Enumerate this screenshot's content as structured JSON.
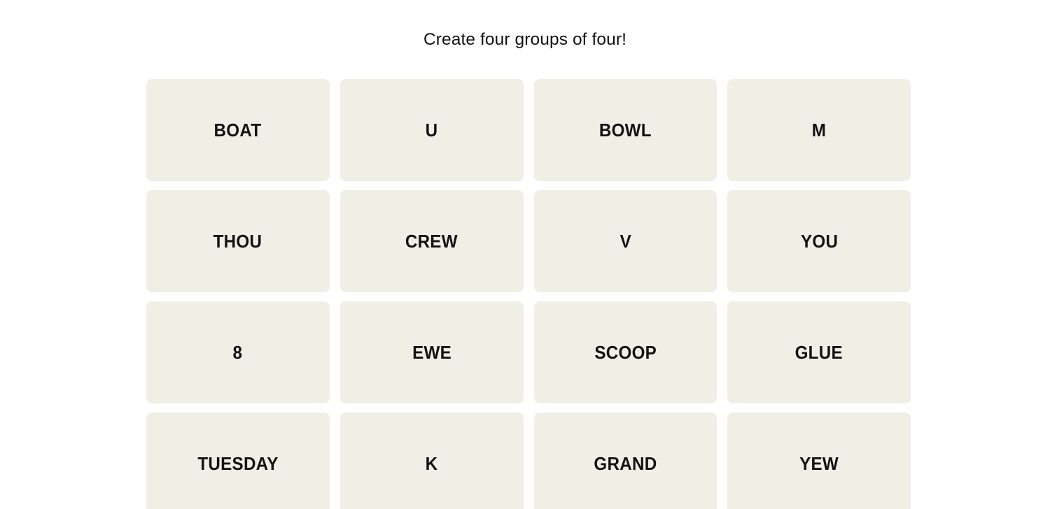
{
  "page": {
    "background_color": "#ffffff",
    "text_color": "#121212"
  },
  "header": {
    "instructions": "Create four groups of four!"
  },
  "board": {
    "rows": 4,
    "columns": 4,
    "tile_color": "#efefe6",
    "tile_text_color": "#121212",
    "tiles": [
      {
        "label": "BOAT"
      },
      {
        "label": "U"
      },
      {
        "label": "BOWL"
      },
      {
        "label": "M"
      },
      {
        "label": "THOU"
      },
      {
        "label": "CREW"
      },
      {
        "label": "V"
      },
      {
        "label": "YOU"
      },
      {
        "label": "8"
      },
      {
        "label": "EWE"
      },
      {
        "label": "SCOOP"
      },
      {
        "label": "GLUE"
      },
      {
        "label": "TUESDAY"
      },
      {
        "label": "K"
      },
      {
        "label": "GRAND"
      },
      {
        "label": "YEW"
      }
    ]
  }
}
